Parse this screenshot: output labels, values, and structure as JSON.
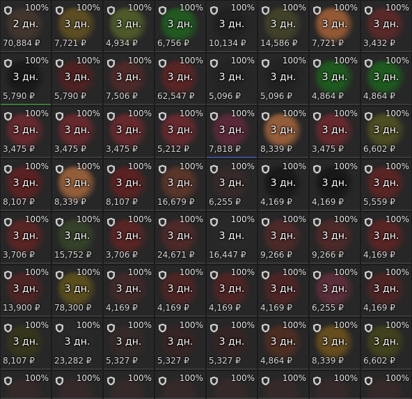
{
  "currency": "₽",
  "rows": [
    [
      {
        "pct": "100%",
        "duration": "2 дн.",
        "price": "70,884",
        "color": "#4a3a30",
        "quality": "gray"
      },
      {
        "pct": "100%",
        "duration": "3 дн.",
        "price": "7,721",
        "color": "#6d5a1f",
        "quality": "gray"
      },
      {
        "pct": "100%",
        "duration": "3 дн.",
        "price": "4,934",
        "color": "#5a6a2a",
        "quality": "gray"
      },
      {
        "pct": "100%",
        "duration": "3 дн.",
        "price": "6,756",
        "color": "#1f6a1f",
        "quality": "gray"
      },
      {
        "pct": "100%",
        "duration": "3 дн.",
        "price": "10,134",
        "color": "#1e1e1e",
        "quality": "gray"
      },
      {
        "pct": "100%",
        "duration": "3 дн.",
        "price": "14,586",
        "color": "#4a4a2a",
        "quality": "gray"
      },
      {
        "pct": "100%",
        "duration": "3 дн.",
        "price": "7,721",
        "color": "#b86a3a",
        "quality": "gray"
      },
      {
        "pct": "100%",
        "duration": "3 дн.",
        "price": "3,432",
        "color": "#6a2a2a",
        "quality": "gray"
      }
    ],
    [
      {
        "pct": "100%",
        "duration": "3 дн.",
        "price": "5,790",
        "color": "#151515",
        "quality": "green"
      },
      {
        "pct": "100%",
        "duration": "3 дн.",
        "price": "5,790",
        "color": "#5a2020",
        "quality": "gray"
      },
      {
        "pct": "100%",
        "duration": "3 дн.",
        "price": "7,506",
        "color": "#5a2a2a",
        "quality": "gray"
      },
      {
        "pct": "100%",
        "duration": "3 дн.",
        "price": "62,547",
        "color": "#6a2424",
        "quality": "gray"
      },
      {
        "pct": "100%",
        "duration": "3 дн.",
        "price": "5,096",
        "color": "#222222",
        "quality": "gray"
      },
      {
        "pct": "100%",
        "duration": "3 дн.",
        "price": "5,096",
        "color": "#202020",
        "quality": "gray"
      },
      {
        "pct": "100%",
        "duration": "3 дн.",
        "price": "4,864",
        "color": "#1c6a1c",
        "quality": "gray"
      },
      {
        "pct": "100%",
        "duration": "3 дн.",
        "price": "4,864",
        "color": "#1c6a1c",
        "quality": "gray"
      }
    ],
    [
      {
        "pct": "100%",
        "duration": "3 дн.",
        "price": "3,475",
        "color": "#7a2a30",
        "quality": "gray"
      },
      {
        "pct": "100%",
        "duration": "3 дн.",
        "price": "3,475",
        "color": "#7a2a30",
        "quality": "gray"
      },
      {
        "pct": "100%",
        "duration": "3 дн.",
        "price": "3,475",
        "color": "#7a2a30",
        "quality": "gray"
      },
      {
        "pct": "100%",
        "duration": "3 дн.",
        "price": "5,212",
        "color": "#7a2a30",
        "quality": "gray"
      },
      {
        "pct": "100%",
        "duration": "3 дн.",
        "price": "7,818",
        "color": "#6a2a40",
        "quality": "blue"
      },
      {
        "pct": "100%",
        "duration": "3 дн.",
        "price": "8,339",
        "color": "#b87040",
        "quality": "gray"
      },
      {
        "pct": "100%",
        "duration": "3 дн.",
        "price": "3,475",
        "color": "#7a2a30",
        "quality": "gray"
      },
      {
        "pct": "100%",
        "duration": "3 дн.",
        "price": "6,602",
        "color": "#5a5a20",
        "quality": "gray"
      }
    ],
    [
      {
        "pct": "100%",
        "duration": "3 дн.",
        "price": "8,107",
        "color": "#6a2020",
        "quality": "gray"
      },
      {
        "pct": "100%",
        "duration": "3 дн.",
        "price": "8,339",
        "color": "#b87040",
        "quality": "gray"
      },
      {
        "pct": "100%",
        "duration": "3 дн.",
        "price": "8,107",
        "color": "#6a2020",
        "quality": "gray"
      },
      {
        "pct": "100%",
        "duration": "3 дн.",
        "price": "16,679",
        "color": "#6a3a2a",
        "quality": "gray"
      },
      {
        "pct": "100%",
        "duration": "3 дн.",
        "price": "6,255",
        "color": "#3a2a2a",
        "quality": "gray"
      },
      {
        "pct": "100%",
        "duration": "3 дн.",
        "price": "4,169",
        "color": "#141414",
        "quality": "gray"
      },
      {
        "pct": "100%",
        "duration": "3 дн.",
        "price": "4,169",
        "color": "#141414",
        "quality": "gray"
      },
      {
        "pct": "100%",
        "duration": "3 дн.",
        "price": "5,559",
        "color": "#6a2424",
        "quality": "gray"
      }
    ],
    [
      {
        "pct": "100%",
        "duration": "3 дн.",
        "price": "3,706",
        "color": "#6a2424",
        "quality": "gray"
      },
      {
        "pct": "100%",
        "duration": "3 дн.",
        "price": "15,752",
        "color": "#3a4a2a",
        "quality": "gray"
      },
      {
        "pct": "100%",
        "duration": "3 дн.",
        "price": "3,706",
        "color": "#6a2424",
        "quality": "gray"
      },
      {
        "pct": "100%",
        "duration": "3 дн.",
        "price": "24,671",
        "color": "#5a2a2a",
        "quality": "gray"
      },
      {
        "pct": "100%",
        "duration": "3 дн.",
        "price": "16,447",
        "color": "#2a2a2a",
        "quality": "gray"
      },
      {
        "pct": "100%",
        "duration": "3 дн.",
        "price": "9,266",
        "color": "#5a2a2a",
        "quality": "gray"
      },
      {
        "pct": "100%",
        "duration": "3 дн.",
        "price": "9,266",
        "color": "#5a2a2a",
        "quality": "gray"
      },
      {
        "pct": "100%",
        "duration": "3 дн.",
        "price": "4,169",
        "color": "#6a2424",
        "quality": "gray"
      }
    ],
    [
      {
        "pct": "100%",
        "duration": "3 дн.",
        "price": "13,900",
        "color": "#5a2424",
        "quality": "gray"
      },
      {
        "pct": "100%",
        "duration": "3 дн.",
        "price": "78,300",
        "color": "#6a5a1a",
        "quality": "gray"
      },
      {
        "pct": "100%",
        "duration": "3 дн.",
        "price": "4,169",
        "color": "#4a2a2a",
        "quality": "gray"
      },
      {
        "pct": "100%",
        "duration": "3 дн.",
        "price": "4,169",
        "color": "#5a2424",
        "quality": "gray"
      },
      {
        "pct": "100%",
        "duration": "3 дн.",
        "price": "4,169",
        "color": "#5a2424",
        "quality": "gray"
      },
      {
        "pct": "100%",
        "duration": "3 дн.",
        "price": "4,169",
        "color": "#5a2424",
        "quality": "gray"
      },
      {
        "pct": "100%",
        "duration": "3 дн.",
        "price": "6,255",
        "color": "#6a3040",
        "quality": "gray"
      },
      {
        "pct": "100%",
        "duration": "3 дн.",
        "price": "4,169",
        "color": "#5a2424",
        "quality": "gray"
      }
    ],
    [
      {
        "pct": "100%",
        "duration": "3 дн.",
        "price": "8,107",
        "color": "#3a3a1a",
        "quality": "gray"
      },
      {
        "pct": "100%",
        "duration": "3 дн.",
        "price": "23,282",
        "color": "#2a2a2a",
        "quality": "gray"
      },
      {
        "pct": "100%",
        "duration": "3 дн.",
        "price": "5,327",
        "color": "#3a2a2a",
        "quality": "gray"
      },
      {
        "pct": "100%",
        "duration": "3 дн.",
        "price": "5,327",
        "color": "#3a2424",
        "quality": "gray"
      },
      {
        "pct": "100%",
        "duration": "3 дн.",
        "price": "5,327",
        "color": "#3a2424",
        "quality": "gray"
      },
      {
        "pct": "100%",
        "duration": "3 дн.",
        "price": "4,864",
        "color": "#5a3020",
        "quality": "gray"
      },
      {
        "pct": "100%",
        "duration": "3 дн.",
        "price": "8,339",
        "color": "#7a5a1a",
        "quality": "gray"
      },
      {
        "pct": "100%",
        "duration": "3 дн.",
        "price": "6,602",
        "color": "#4a4a1a",
        "quality": "gray"
      }
    ],
    [
      {
        "pct": "100%",
        "color": "#3a2a2a",
        "quality": "gray"
      },
      {
        "pct": "100%",
        "color": "#3a2a2a",
        "quality": "gray"
      },
      {
        "pct": "100%",
        "color": "#3a2a2a",
        "quality": "gray"
      },
      {
        "pct": "100%",
        "color": "#3a2a2a",
        "quality": "gray"
      },
      {
        "pct": "100%",
        "color": "#3a2a2a",
        "quality": "gray"
      },
      {
        "pct": "100%",
        "color": "#3a2a2a",
        "quality": "gray"
      },
      {
        "pct": "100%",
        "color": "#3a2a2a",
        "quality": "gray"
      },
      {
        "pct": "100%",
        "color": "#3a2a2a",
        "quality": "gray"
      }
    ]
  ]
}
